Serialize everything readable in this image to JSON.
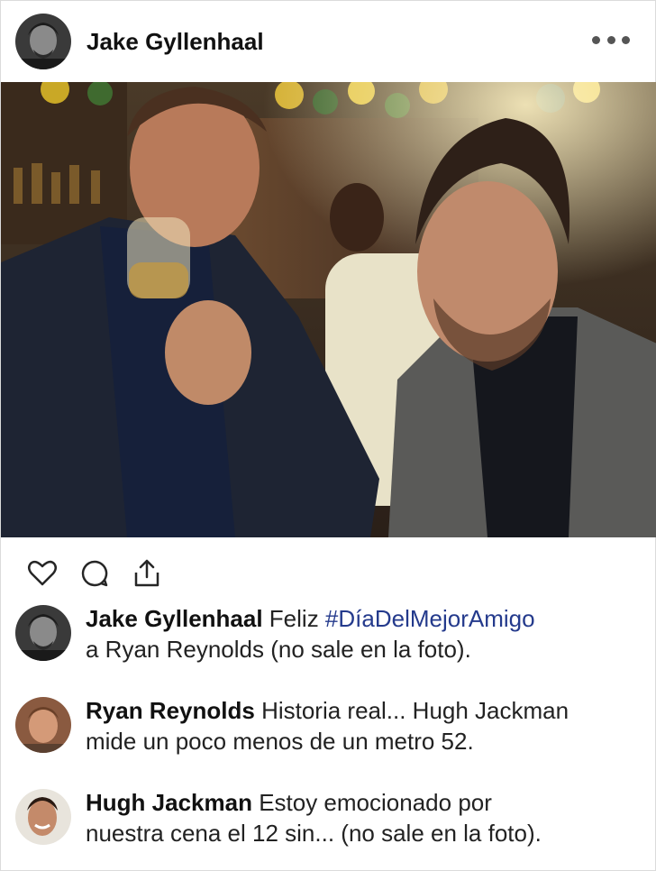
{
  "header": {
    "username": "Jake Gyllenhaal",
    "avatar_icon": "profile-avatar",
    "more_icon": "more-horizontal-icon"
  },
  "photo": {
    "icon": "post-photo"
  },
  "actions": {
    "like_icon": "heart-icon",
    "comment_icon": "comment-bubble-icon",
    "share_icon": "share-upload-icon"
  },
  "comments": [
    {
      "username": "Jake Gyllenhaal",
      "text_prefix": "Feliz ",
      "hashtag": "#DíaDelMejorAmigo",
      "text_line2": "a Ryan Reynolds (no sale en la foto)."
    },
    {
      "username": "Ryan Reynolds",
      "text": "Historia real... Hugh Jackman",
      "text_line2": "mide un poco menos de un metro 52."
    },
    {
      "username": "Hugh Jackman",
      "text": "Estoy emocionado por",
      "text_line2": "nuestra cena el 12 sin... (no sale en la foto)."
    }
  ],
  "colors": {
    "hashtag": "#243a8c",
    "text": "#222222",
    "background": "#ffffff"
  }
}
